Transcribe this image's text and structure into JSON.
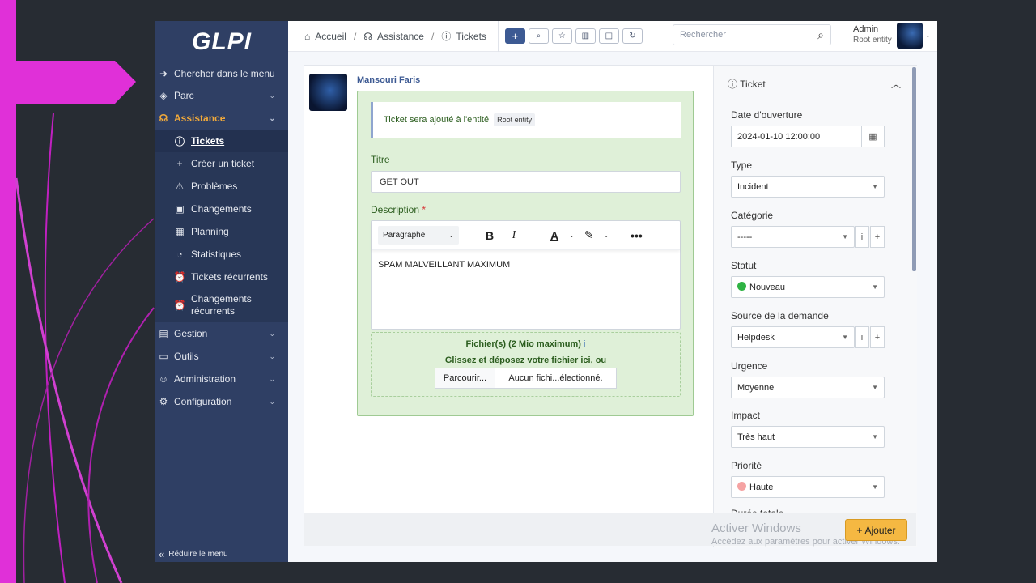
{
  "sidebar": {
    "logo": "GLPI",
    "search_menu": "Chercher dans le menu",
    "items": [
      {
        "label": "Parc"
      },
      {
        "label": "Assistance"
      },
      {
        "label": "Gestion"
      },
      {
        "label": "Outils"
      },
      {
        "label": "Administration"
      },
      {
        "label": "Configuration"
      }
    ],
    "assistance_sub": [
      {
        "label": "Tickets"
      },
      {
        "label": "Créer un ticket"
      },
      {
        "label": "Problèmes"
      },
      {
        "label": "Changements"
      },
      {
        "label": "Planning"
      },
      {
        "label": "Statistiques"
      },
      {
        "label": "Tickets récurrents"
      },
      {
        "label": "Changements récurrents"
      }
    ],
    "collapse": "Réduire le menu"
  },
  "topbar": {
    "breadcrumb": [
      "Accueil",
      "Assistance",
      "Tickets"
    ],
    "search_placeholder": "Rechercher",
    "user_name": "Admin",
    "user_entity": "Root entity"
  },
  "ticket": {
    "author": "Mansouri Faris",
    "entity_notice": "Ticket sera ajouté à l'entité",
    "entity_badge": "Root entity",
    "title_label": "Titre",
    "title_value": "GET OUT",
    "description_label": "Description",
    "required_mark": "*",
    "paragraph_style": "Paragraphe",
    "description_value": "SPAM MALVEILLANT MAXIMUM",
    "files_label": "Fichier(s) (2 Mio maximum)",
    "drop_text": "Glissez et déposez votre fichier ici, ou",
    "browse": "Parcourir...",
    "no_file": "Aucun fichi...électionné."
  },
  "side": {
    "header": "Ticket",
    "fields": {
      "date_label": "Date d'ouverture",
      "date_value": "2024-01-10 12:00:00",
      "type_label": "Type",
      "type_value": "Incident",
      "category_label": "Catégorie",
      "category_value": "-----",
      "status_label": "Statut",
      "status_value": "Nouveau",
      "source_label": "Source de la demande",
      "source_value": "Helpdesk",
      "urgency_label": "Urgence",
      "urgency_value": "Moyenne",
      "impact_label": "Impact",
      "impact_value": "Très haut",
      "priority_label": "Priorité",
      "priority_value": "Haute",
      "partial_label": "Durée totale"
    },
    "status_color": "#2fb344",
    "priority_color": "#f5a3a3"
  },
  "footer": {
    "add_button": "Ajouter",
    "watermark_title": "Activer Windows",
    "watermark_sub": "Accédez aux paramètres pour activer Windows."
  }
}
